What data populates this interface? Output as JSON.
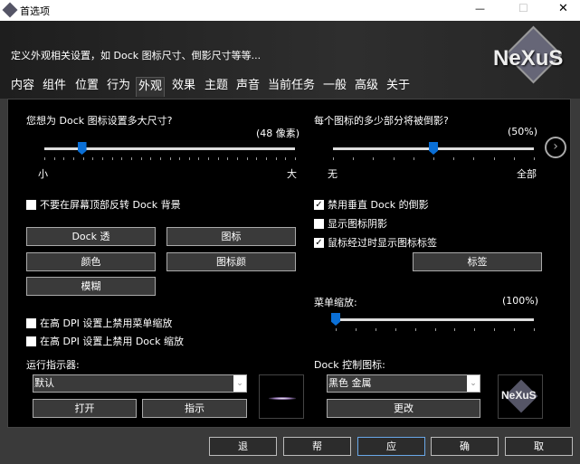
{
  "window": {
    "title": "首选项",
    "minimize": "—",
    "maximize": "☐",
    "close": "✕"
  },
  "header": {
    "description": "定义外观相关设置，如 Dock 图标尺寸、倒影尺寸等等...",
    "logo": "NeXuS"
  },
  "tabs": [
    "内容",
    "组件",
    "位置",
    "行为",
    "外观",
    "效果",
    "主题",
    "声音",
    "当前任务",
    "一般",
    "高级",
    "关于"
  ],
  "active_tab": "外观",
  "size": {
    "label": "您想为 Dock 图标设置多大尺寸?",
    "value_text": "(48 像素)",
    "min_label": "小",
    "max_label": "大",
    "value_fraction": 0.15
  },
  "reflection": {
    "label": "每个图标的多少部分将被倒影?",
    "value_text": "(50%)",
    "min_label": "无",
    "max_label": "全部",
    "value_fraction": 0.5
  },
  "checkboxes_left": [
    {
      "label": "不要在屏幕顶部反转 Dock 背景",
      "checked": false
    }
  ],
  "checkboxes_right": [
    {
      "label": "禁用垂直 Dock 的倒影",
      "checked": true
    },
    {
      "label": "显示图标阴影",
      "checked": false
    },
    {
      "label": "鼠标经过时显示图标标签",
      "checked": true
    }
  ],
  "buttons": {
    "dock_trans": "Dock 透",
    "icon": "图标",
    "color": "颜色",
    "icon_color": "图标颜",
    "blur": "模糊",
    "labels": "标签",
    "open": "打开",
    "indicate": "指示",
    "change": "更改"
  },
  "menu_zoom": {
    "label": "菜单缩放:",
    "value_text": "(100%)",
    "value_fraction": 0
  },
  "dpi": [
    {
      "label": "在高 DPI 设置上禁用菜单缩放",
      "checked": false
    },
    {
      "label": "在高 DPI 设置上禁用 Dock 缩放",
      "checked": false
    }
  ],
  "indicator": {
    "label": "运行指示器:",
    "value": "默认"
  },
  "dock_control": {
    "label": "Dock 控制图标:",
    "value": "黑色 金属",
    "preview_logo": "NeXuS"
  },
  "footer": [
    "退",
    "帮",
    "应",
    "确",
    "取"
  ],
  "colors": {
    "accent": "#0a6fd6"
  }
}
